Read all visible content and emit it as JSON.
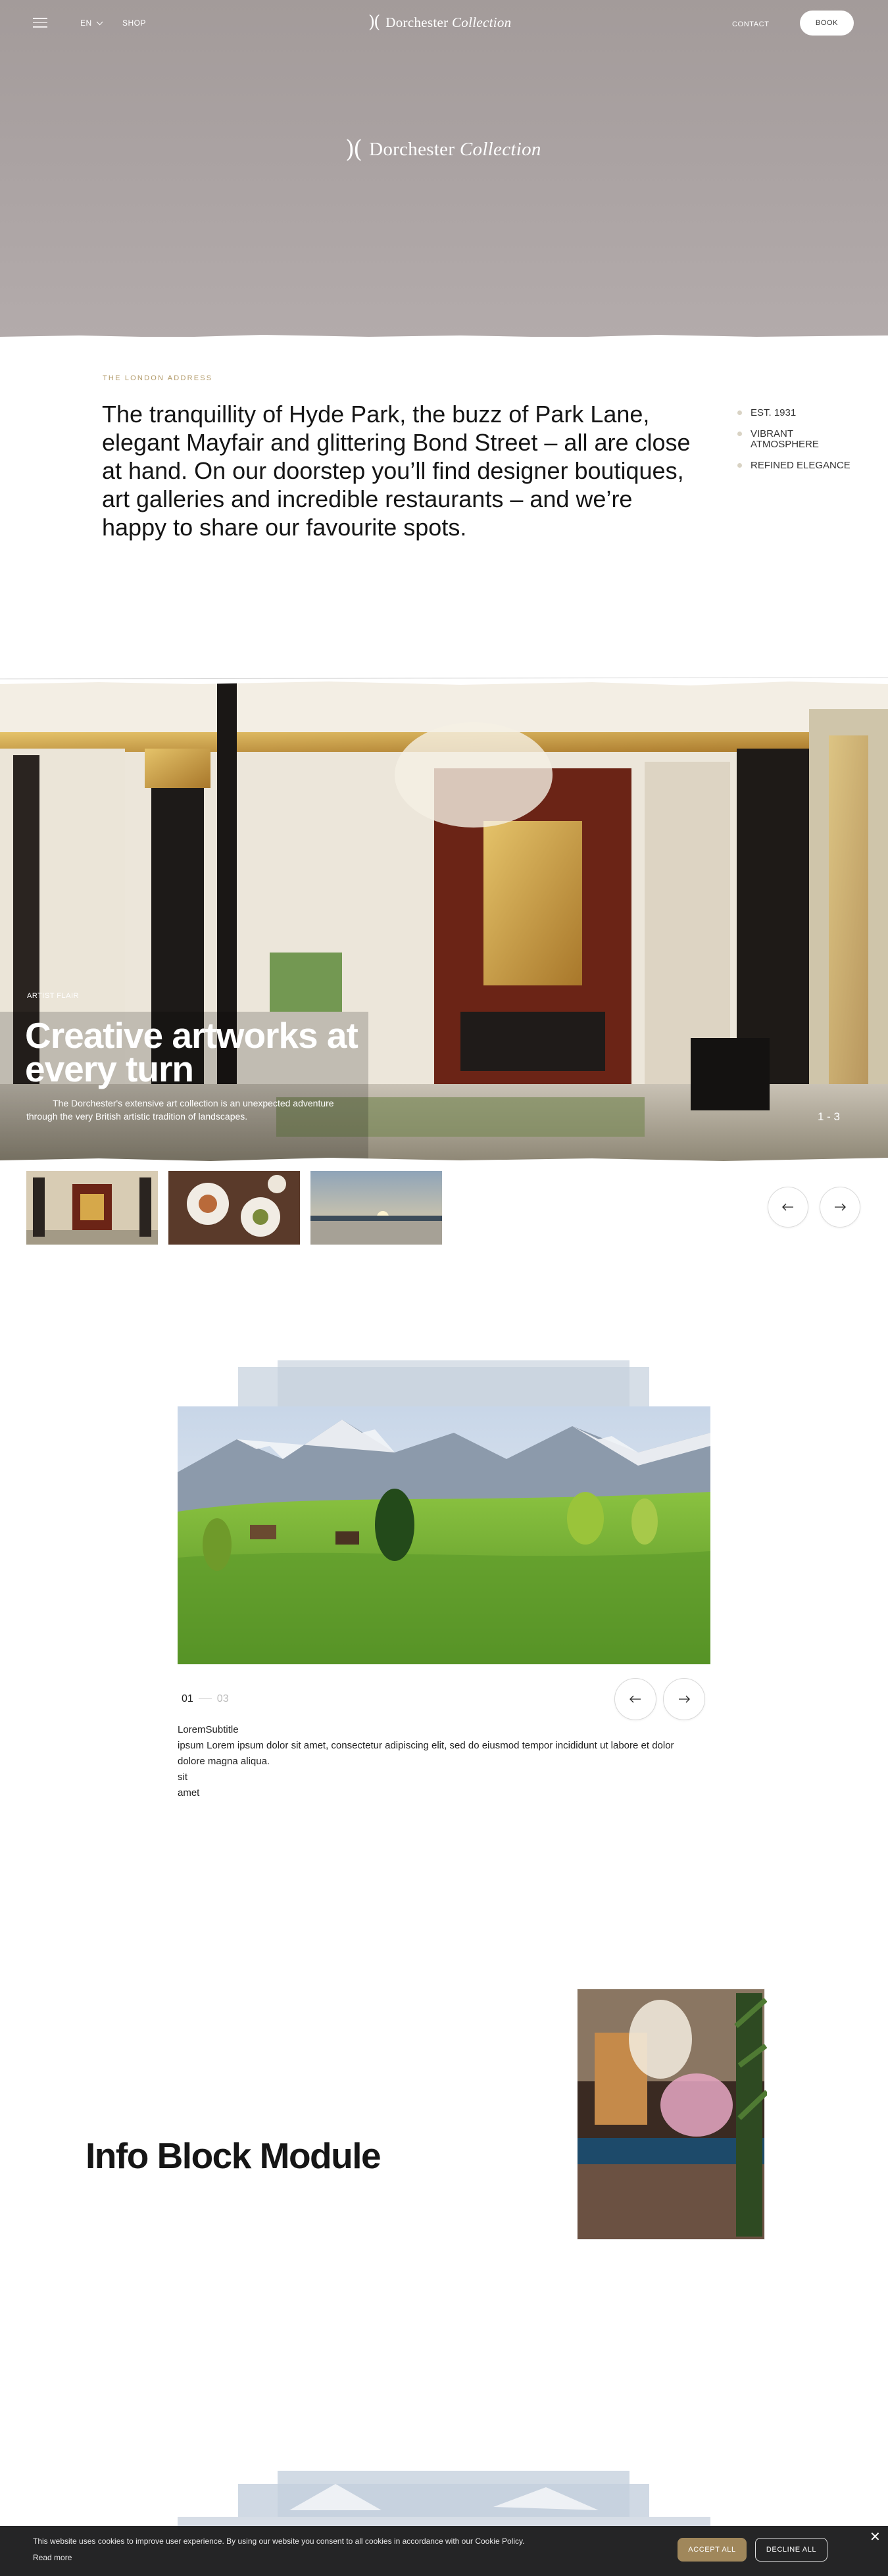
{
  "header": {
    "language": "EN",
    "shop_label": "SHOP",
    "brand_primary": "Dorchester",
    "brand_secondary": "Collection",
    "contact_label": "CONTACT",
    "book_label": "BOOK"
  },
  "hero": {
    "brand_primary": "Dorchester",
    "brand_secondary": "Collection"
  },
  "intro": {
    "eyebrow": "THE LONDON ADDRESS",
    "text": "The tranquillity of Hyde Park, the buzz of Park Lane, elegant Mayfair and glittering Bond Street – all are close at hand. On our doorstep you’ll find designer boutiques, art galleries and incredible restaurants – and we’re happy to share our favourite spots.",
    "facts": [
      "EST. 1931",
      "VIBRANT ATMOSPHERE",
      "REFINED ELEGANCE"
    ]
  },
  "art_carousel": {
    "label": "ARTIST FLAIR",
    "title": "Creative artworks at every turn",
    "description": "The Dorchester's extensive art collection is an unexpected adventure through the very British artistic tradition of landscapes.",
    "counter": "1 - 3"
  },
  "stack_slider": {
    "current": "01",
    "total": "03",
    "title": "LoremSubtitle",
    "body": "ipsum Lorem ipsum dolor sit amet, consectetur adipiscing elit, sed do eiusmod tempor incididunt ut labore et dolor  dolore magna aliqua.",
    "line2": "sit",
    "line3": "amet"
  },
  "info_block": {
    "title": "Info Block Module"
  },
  "cookie": {
    "text": "This website uses cookies to improve user experience. By using our website you consent to all cookies in accordance with our Cookie Policy.",
    "read_more": "Read more",
    "accept_label": "ACCEPT ALL",
    "decline_label": "DECLINE ALL"
  },
  "colors": {
    "accent_gold": "#b29a69",
    "accept_button": "#a0875b",
    "hero_bg": "#aaa2a2"
  }
}
